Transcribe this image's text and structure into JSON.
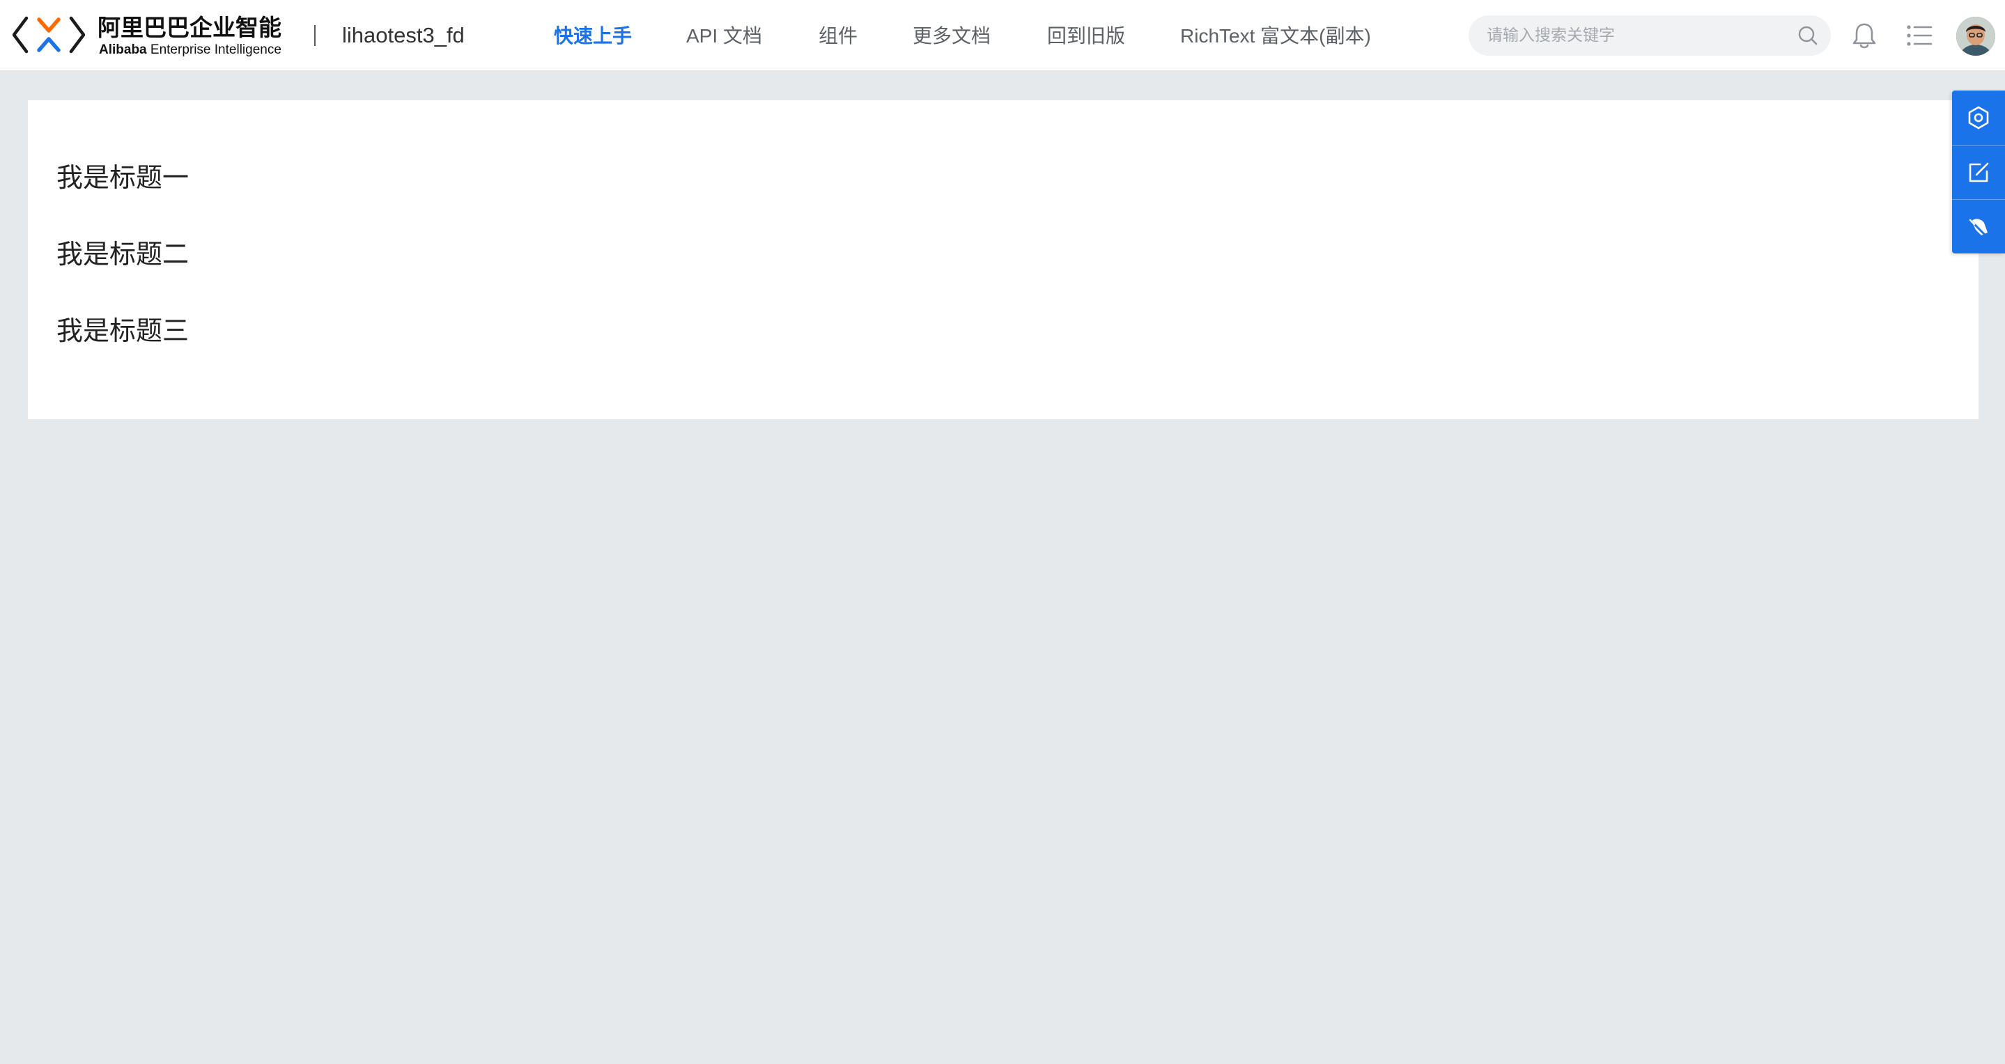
{
  "header": {
    "logo": {
      "cn_text": "阿里巴巴企业智能",
      "en_bold": "Alibaba",
      "en_rest": " Enterprise Intelligence",
      "brand_colors": [
        "#1a73e8",
        "#ff6a00"
      ]
    },
    "app_name": "lihaotest3_fd",
    "nav": [
      {
        "label": "快速上手",
        "active": true
      },
      {
        "label": "API 文档",
        "active": false
      },
      {
        "label": "组件",
        "active": false
      },
      {
        "label": "更多文档",
        "active": false
      },
      {
        "label": "回到旧版",
        "active": false
      },
      {
        "label": "RichText 富文本(副本)",
        "active": false
      }
    ],
    "search": {
      "placeholder": "请输入搜索关键字",
      "icon": "search-icon"
    },
    "icons": [
      "bell-icon",
      "list-icon",
      "avatar"
    ]
  },
  "content": {
    "headings": [
      "我是标题一",
      "我是标题二",
      "我是标题三"
    ]
  },
  "side_toolbar": {
    "icons": [
      "settings-icon",
      "edit-icon",
      "paint-icon"
    ]
  },
  "colors": {
    "accent": "#1a73e8",
    "page_background": "#e5e9ec",
    "card_background": "#ffffff"
  }
}
